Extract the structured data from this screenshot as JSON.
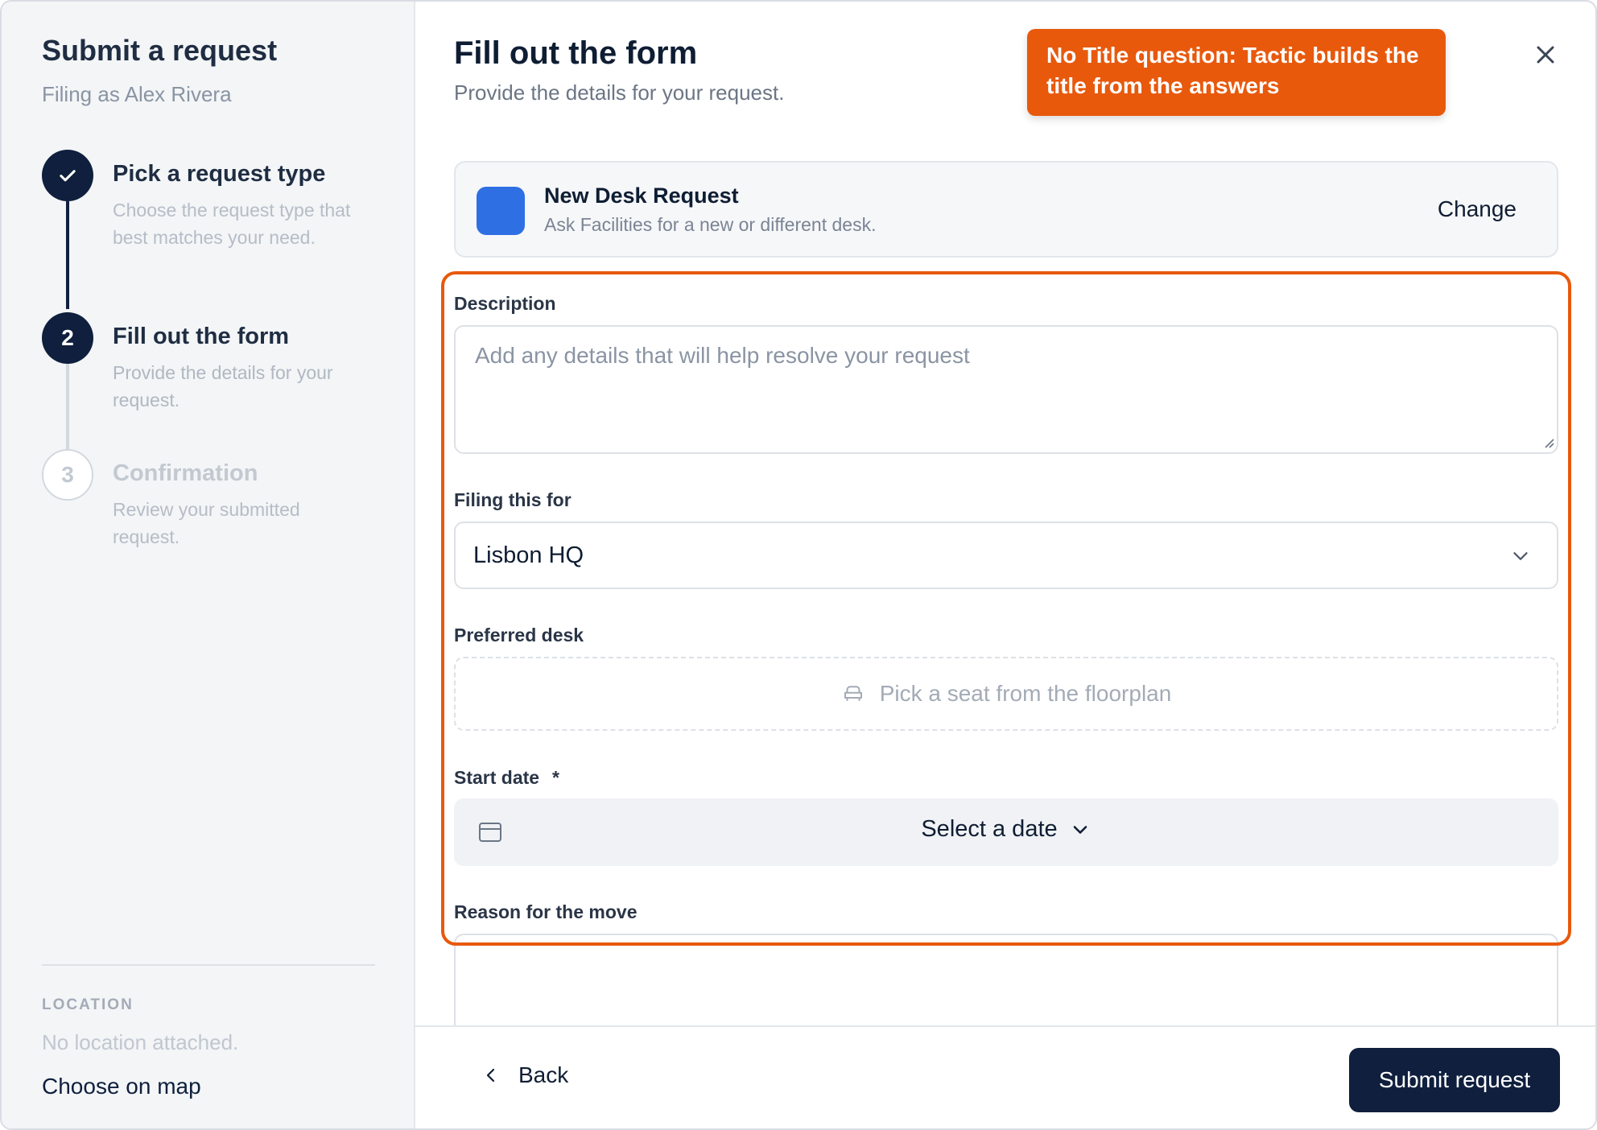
{
  "sidebar": {
    "title": "Submit a request",
    "subtitle": "Filing as Alex Rivera",
    "steps": [
      {
        "number": "",
        "title": "Pick a request type",
        "description": "Choose the request type that best matches your need.",
        "state": "done"
      },
      {
        "number": "2",
        "title": "Fill out the form",
        "description": "Provide the details for your request.",
        "state": "active"
      },
      {
        "number": "3",
        "title": "Confirmation",
        "description": "Review your submitted request.",
        "state": "todo"
      }
    ],
    "location": {
      "label": "LOCATION",
      "empty_text": "No location attached.",
      "link": "Choose on map"
    }
  },
  "main": {
    "title": "Fill out the form",
    "subtitle": "Provide the details for your request.",
    "callout": "No Title question: Tactic builds the title from the answers",
    "request_type": {
      "name": "New Desk Request",
      "description": "Ask Facilities for a new or different desk.",
      "change_label": "Change",
      "color": "#2f6fe4"
    },
    "fields": {
      "description": {
        "label": "Description",
        "placeholder": "Add any details that will help resolve your request",
        "value": ""
      },
      "filing_for": {
        "label": "Filing this for",
        "value": "Lisbon HQ"
      },
      "preferred_desk": {
        "label": "Preferred desk",
        "placeholder": "Pick a seat from the floorplan"
      },
      "start_date": {
        "label": "Start date",
        "required_mark": "*",
        "placeholder": "Select a date"
      },
      "reason": {
        "label": "Reason for the move",
        "value": ""
      }
    }
  },
  "footer": {
    "back_label": "Back",
    "submit_label": "Submit request"
  },
  "colors": {
    "primary": "#0f1f3d",
    "accent": "#e8590c",
    "sidebar_bg": "#f3f5f7"
  }
}
